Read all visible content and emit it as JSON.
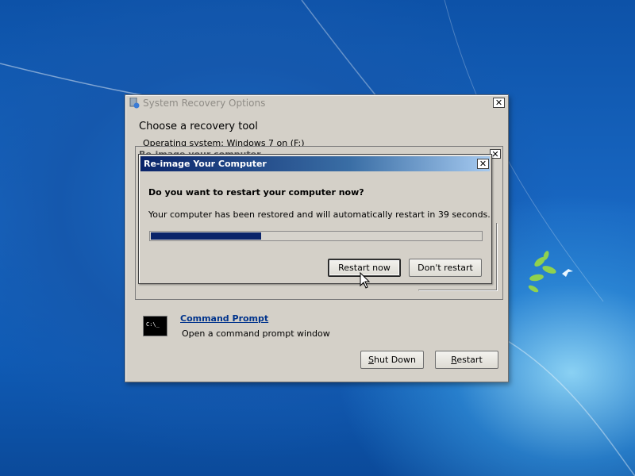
{
  "main_window": {
    "title": "System Recovery Options",
    "close_glyph": "✕",
    "heading": "Choose a recovery tool",
    "os_line": "Operating system: Windows 7 on (F:) System",
    "command_prompt": {
      "icon_text": "C:\\_",
      "link_label": "Command Prompt",
      "description": "Open a command prompt window"
    },
    "shutdown_label": "Shut Down",
    "restart_label": "Restart"
  },
  "background_window": {
    "title": "Re-image your computer",
    "close_glyph": "✕"
  },
  "dialog": {
    "title": "Re-image Your Computer",
    "close_glyph": "✕",
    "question": "Do you want to restart your computer now?",
    "message": "Your computer has been restored and will automatically restart in 39 seconds.",
    "progress_fraction": 0.335,
    "restart_now_label": "Restart now",
    "dont_restart_label": "Don't restart"
  },
  "colors": {
    "dialog_title_start": "#0a246a",
    "dialog_title_end": "#a6caf0",
    "progress_fill": "#0a246a",
    "link": "#00338c"
  }
}
